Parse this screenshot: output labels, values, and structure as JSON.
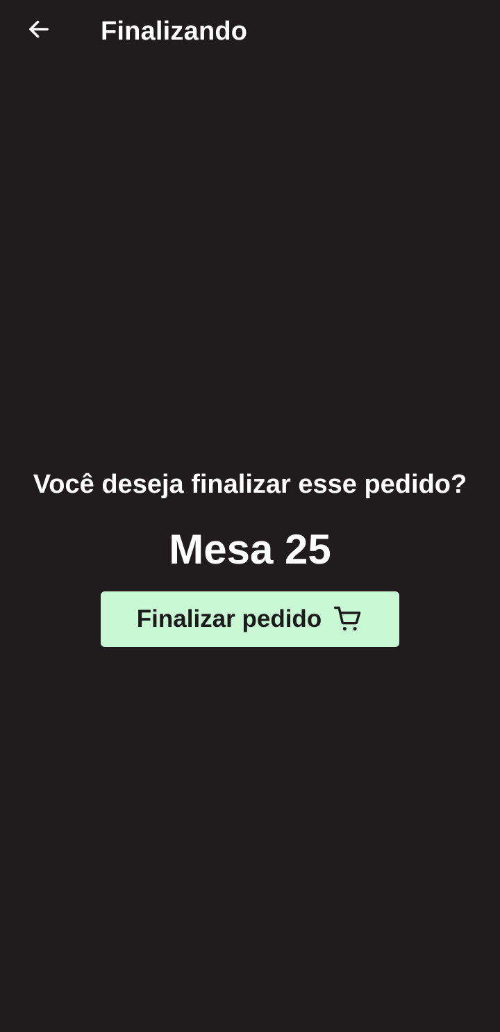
{
  "app_bar": {
    "back_icon": "arrow-left-icon",
    "title": "Finalizando"
  },
  "main": {
    "question": "Você deseja finalizar esse pedido?",
    "table_label": "Mesa 25",
    "finalize_button": {
      "label": "Finalizar pedido",
      "icon": "shopping-cart-icon"
    }
  },
  "colors": {
    "background": "#201b1d",
    "text": "#ffffff",
    "button_background": "#c8f8d4",
    "button_text": "#1c1a1b"
  }
}
